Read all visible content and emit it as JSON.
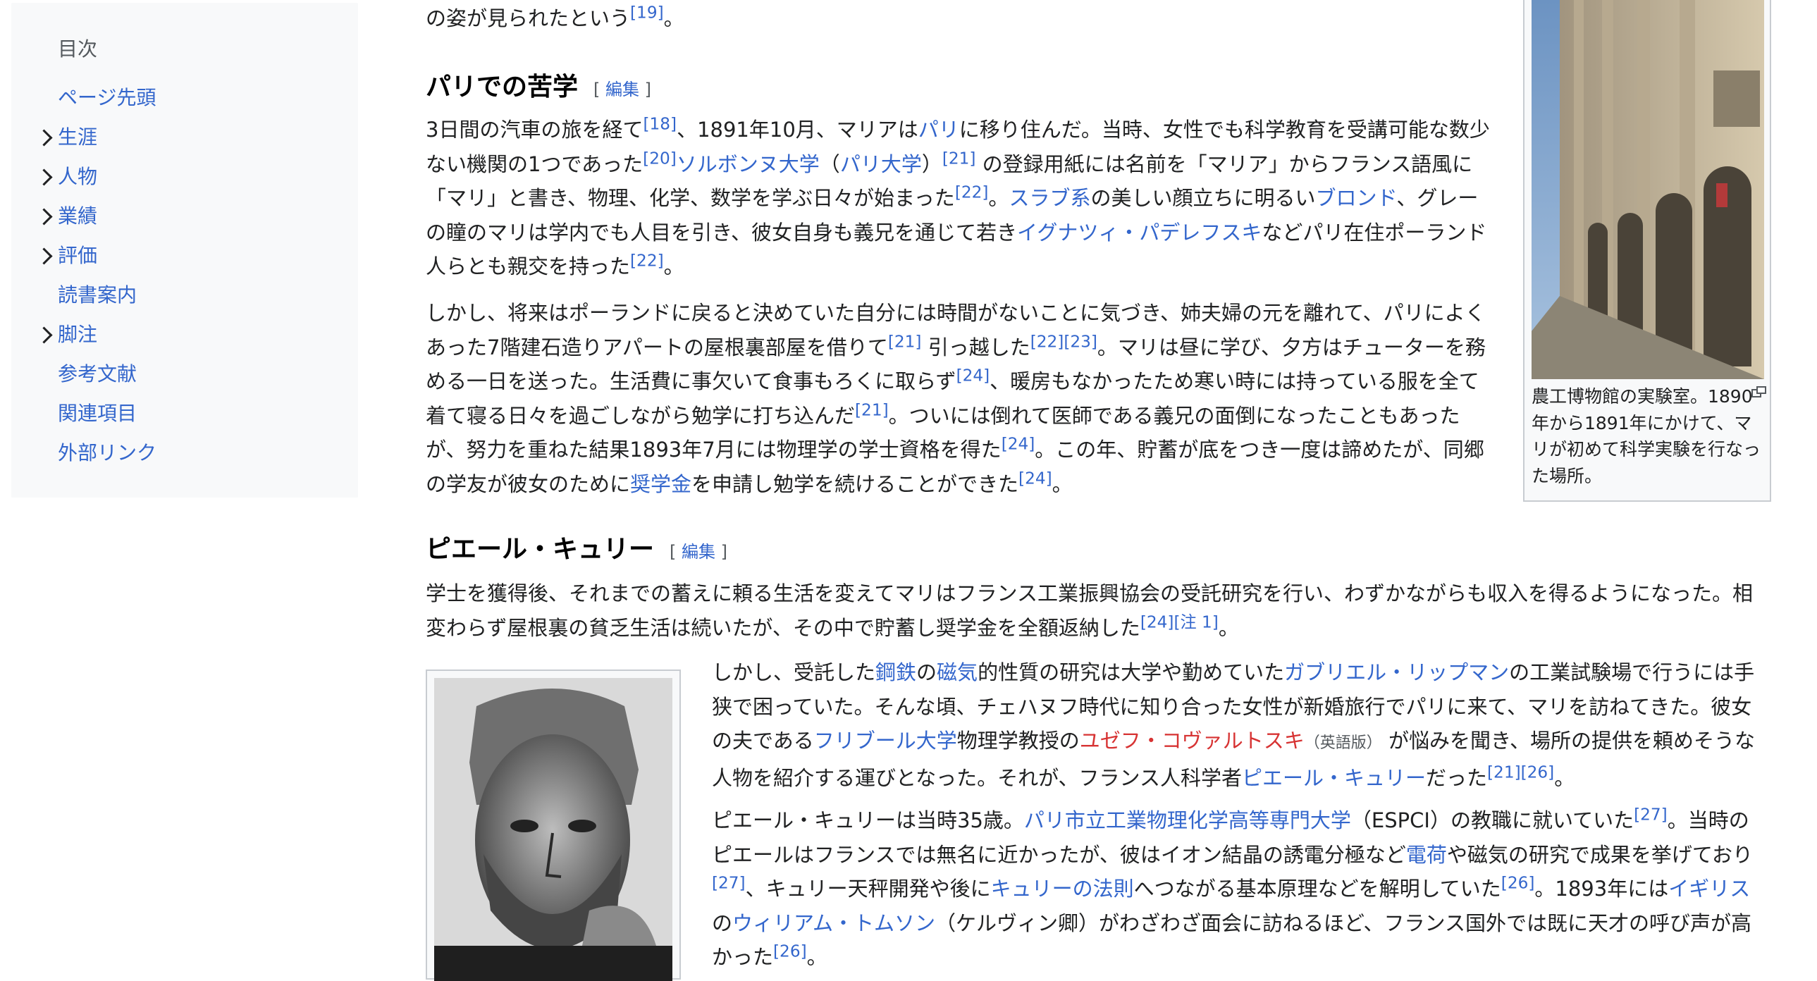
{
  "toc": {
    "title": "目次",
    "items": [
      {
        "label": "ページ先頭",
        "expandable": false
      },
      {
        "label": "生涯",
        "expandable": true
      },
      {
        "label": "人物",
        "expandable": true
      },
      {
        "label": "業績",
        "expandable": true
      },
      {
        "label": "評価",
        "expandable": true
      },
      {
        "label": "読書案内",
        "expandable": false
      },
      {
        "label": "脚注",
        "expandable": true
      },
      {
        "label": "参考文献",
        "expandable": false
      },
      {
        "label": "関連項目",
        "expandable": false
      },
      {
        "label": "外部リンク",
        "expandable": false
      }
    ]
  },
  "intro_line": {
    "text": "の姿が見られたという",
    "ref": "[19]",
    "end": "。"
  },
  "section_paris": {
    "title": "パリでの苦学",
    "edit": "編集",
    "p1": {
      "t1": "3日間の汽車の旅を経て",
      "r1": "[18]",
      "t2": "、1891年10月、マリアは",
      "l1": "パリ",
      "t3": "に移り住んだ。当時、女性でも科学教育を受講可能な数少ない機関の1つであった",
      "r2": "[20]",
      "l2": "ソルボンヌ大学",
      "t4": "（",
      "l3": "パリ大学",
      "t5": "）",
      "r3": "[21]",
      "t6": " の登録用紙には名前を「マリア」からフランス語風に「マリ」と書き、物理、化学、数学を学ぶ日々が始まった",
      "r4": "[22]",
      "t7": "。",
      "l4": "スラブ系",
      "t8": "の美しい顔立ちに明るい",
      "l5": "ブロンド",
      "t9": "、グレーの瞳のマリは学内でも人目を引き、彼女自身も義兄を通じて若き",
      "l6": "イグナツィ・パデレフスキ",
      "t10": "などパリ在住ポーランド人らとも親交を持った",
      "r5": "[22]",
      "t11": "。"
    },
    "p2": {
      "t1": "しかし、将来はポーランドに戻ると決めていた自分には時間がないことに気づき、姉夫婦の元を離れて、パリによくあった7階建石造りアパートの屋根裏部屋を借りて",
      "r1": "[21]",
      "t2": " 引っ越した",
      "r2": "[22]",
      "r3": "[23]",
      "t3": "。マリは昼に学び、夕方はチューターを務める一日を送った。生活費に事欠いて食事もろくに取らず",
      "r4": "[24]",
      "t4": "、暖房もなかったため寒い時には持っている服を全て着て寝る日々を過ごしながら勉学に打ち込んだ",
      "r5": "[21]",
      "t5": "。ついには倒れて医師である義兄の面倒になったこともあったが、努力を重ねた結果1893年7月には物理学の学士資格を得た",
      "r6": "[24]",
      "t6": "。この年、貯蓄が底をつき一度は諦めたが、同郷の学友が彼女のために",
      "l1": "奨学金",
      "t7": "を申請し勉学を続けることができた",
      "r7": "[24]",
      "t8": "。"
    }
  },
  "thumb1": {
    "caption": "農工博物館の実験室。1890年から1891年にかけて、マリが初めて科学実験を行なった場所。",
    "icon": "magnify-icon"
  },
  "section_pierre": {
    "title": "ピエール・キュリー",
    "edit": "編集",
    "p1": {
      "t1": "学士を獲得後、それまでの蓄えに頼る生活を変えてマリはフランス工業振興協会の受託研究を行い、わずかながらも収入を得るようになった。相変わらず屋根裏の貧乏生活は続いたが、その中で貯蓄し奨学金を全額返納した",
      "r1": "[24]",
      "r2": "[注 1]",
      "t2": "。"
    },
    "p2": {
      "t1": "しかし、受託した",
      "l1": "鋼鉄",
      "t2": "の",
      "l2": "磁気",
      "t3": "的性質の研究は大学や勤めていた",
      "l3": "ガブリエル・リップマン",
      "t4": "の工業試験場で行うには手狭で困っていた。そんな頃、チェハヌフ時代に知り合った女性が新婚旅行でパリに来て、マリを訪ねてきた。彼女の夫である",
      "l4": "フリブール大学",
      "t5": "物理学教授の",
      "l5": "ユゼフ・コヴァルトスキ",
      "l6": "（英語版）",
      "t6": " が悩みを聞き、場所の提供を頼めそうな人物を紹介する運びとなった。それが、フランス人科学者",
      "l7": "ピエール・キュリー",
      "t7": "だった",
      "r1": "[21]",
      "r2": "[26]",
      "t8": "。"
    },
    "p3": {
      "t1": "ピエール・キュリーは当時35歳。",
      "l1": "パリ市立工業物理化学高等専門大学",
      "t2": "（ESPCI）の教職に就いていた",
      "r1": "[27]",
      "t3": "。当時のピエールはフランスでは無名に近かったが、彼はイオン結晶の誘電分極など",
      "l2": "電荷",
      "t4": "や磁気の研究で成果を挙げており",
      "r2": "[27]",
      "t5": "、キュリー天秤開発や後に",
      "l3": "キュリーの法則",
      "t6": "へつながる基本原理などを解明していた",
      "r3": "[26]",
      "t7": "。1893年には",
      "l4": "イギリス",
      "t8": "の",
      "l5": "ウィリアム・トムソン",
      "t9": "（ケルヴィン卿）がわざわざ面会に訪ねるほど、フランス国外では既に天才の呼び声が高かった",
      "r4": "[26]",
      "t10": "。"
    }
  }
}
